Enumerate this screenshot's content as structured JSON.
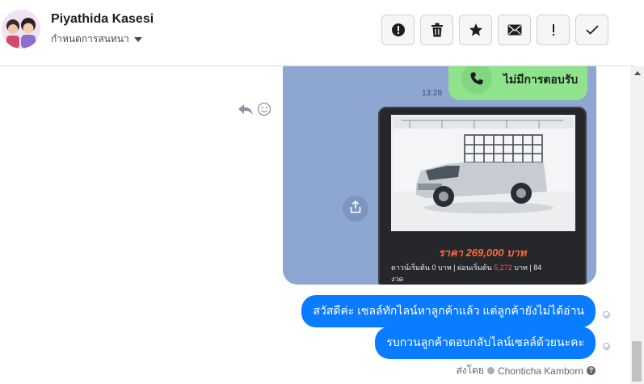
{
  "contact": {
    "name": "Piyathida Kasesi",
    "assign_label": "กำหนดการสนทนา"
  },
  "toolbar": {
    "buttons": [
      "alert-icon",
      "trash-icon",
      "star-icon",
      "envelope-icon",
      "exclamation-icon",
      "check-icon"
    ]
  },
  "image_message": {
    "call_status": "ไม่มีการตอบรับ",
    "time": "13:28",
    "price_text": "ราคา 269,000 บาท",
    "terms_prefix": "ดาวน์เริ่มต้น 0 บาท | ผ่อนเริ่มต้น",
    "terms_highlight": "5,272",
    "terms_suffix": "บาท | 84",
    "terms_line2": "งวด"
  },
  "messages": [
    {
      "text": "สวัสดีค่ะ เซลล์ทักไลน์หาลูกค้าแล้ว แต่ลูกค้ายังไม่ได้อ่าน"
    },
    {
      "text": "รบกวนลูกค้าตอบกลับไลน์เซลล์ด้วยนะคะ"
    }
  ],
  "footer": {
    "sent_by_label": "ส่งโดย",
    "sender": "Chonticha Kamborn"
  },
  "colors": {
    "bubble": "#0a7cff",
    "chat_bg": "#8ea6d2",
    "call_bubble": "#8fe38c",
    "price": "#ff6a3d"
  }
}
